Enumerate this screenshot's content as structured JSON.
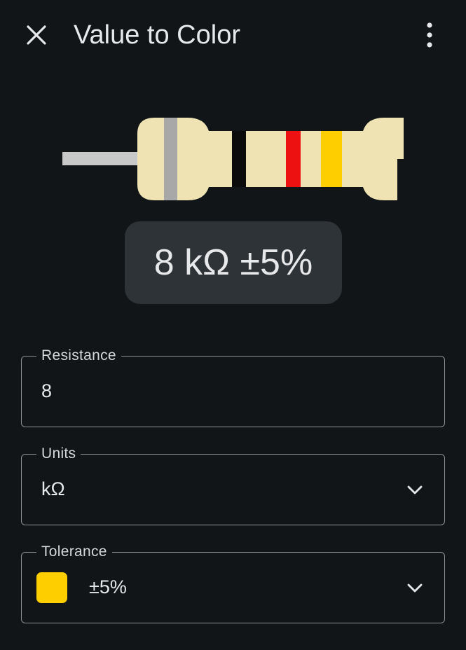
{
  "app_bar": {
    "title": "Value to Color",
    "close_icon": "close-icon",
    "menu_icon": "more-vertical-icon"
  },
  "resistor": {
    "body_color": "#efe3b3",
    "lead_color": "#c8c8c8",
    "bands": [
      {
        "name": "tolerance-band-silver",
        "color": "#a8a8a8"
      },
      {
        "name": "first-digit-band",
        "color": "#0b0b0b"
      },
      {
        "name": "second-digit-band",
        "color": "#ee1111"
      },
      {
        "name": "multiplier-band",
        "color": "#ffce00"
      }
    ]
  },
  "result": {
    "text": "8 kΩ ±5%"
  },
  "fields": {
    "resistance": {
      "label": "Resistance",
      "value": "8"
    },
    "units": {
      "label": "Units",
      "value": "kΩ",
      "icon": "chevron-down-icon"
    },
    "tolerance": {
      "label": "Tolerance",
      "value": "±5%",
      "swatch_color": "#ffce00",
      "icon": "chevron-down-icon"
    }
  }
}
